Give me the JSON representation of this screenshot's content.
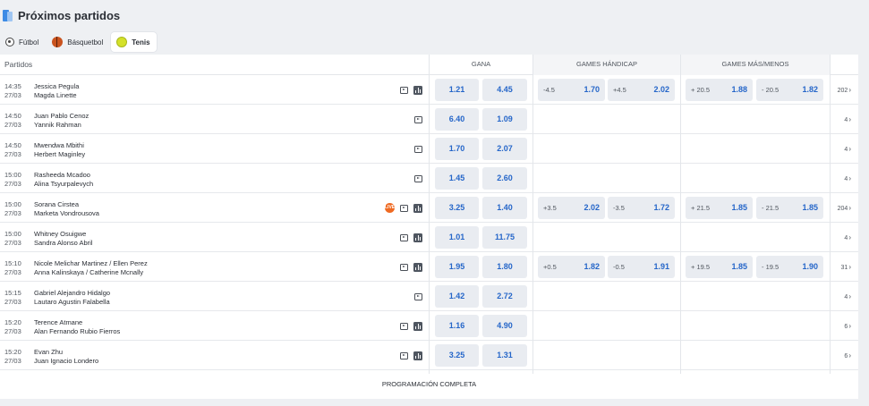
{
  "header": {
    "title": "Próximos partidos"
  },
  "tabs": [
    {
      "label": "Fútbol",
      "icon": "soccer-ball-icon"
    },
    {
      "label": "Básquetbol",
      "icon": "basketball-icon"
    },
    {
      "label": "Tenis",
      "icon": "tennis-ball-icon",
      "active": true
    }
  ],
  "table": {
    "columns": {
      "matches": "Partidos",
      "win": "GANA",
      "handicap": "GAMES HÁNDICAP",
      "overunder": "GAMES MÁS/MENOS"
    },
    "rows": [
      {
        "time": "14:35",
        "date": "27/03",
        "team1": "Jessica Pegula",
        "team2": "Magda Linette",
        "live": false,
        "stats": true,
        "win": [
          "1.21",
          "4.45"
        ],
        "handicap": [
          {
            "label": "-4.5",
            "value": "1.70"
          },
          {
            "label": "+4.5",
            "value": "2.02"
          }
        ],
        "overunder": [
          {
            "label": "+ 20.5",
            "value": "1.88"
          },
          {
            "label": "- 20.5",
            "value": "1.82"
          }
        ],
        "more": "202"
      },
      {
        "time": "14:50",
        "date": "27/03",
        "team1": "Juan Pablo Cenoz",
        "team2": "Yannik Rahman",
        "live": false,
        "stats": false,
        "win": [
          "6.40",
          "1.09"
        ],
        "handicap": [],
        "overunder": [],
        "more": "4"
      },
      {
        "time": "14:50",
        "date": "27/03",
        "team1": "Mwendwa Mbithi",
        "team2": "Herbert Maginley",
        "live": false,
        "stats": false,
        "win": [
          "1.70",
          "2.07"
        ],
        "handicap": [],
        "overunder": [],
        "more": "4"
      },
      {
        "time": "15:00",
        "date": "27/03",
        "team1": "Rasheeda Mcadoo",
        "team2": "Alina Tsyurpalevych",
        "live": false,
        "stats": false,
        "notv": true,
        "win": [
          "1.45",
          "2.60"
        ],
        "handicap": [],
        "overunder": [],
        "more": "4"
      },
      {
        "time": "15:00",
        "date": "27/03",
        "team1": "Sorana Cirstea",
        "team2": "Marketa Vondrousova",
        "live": true,
        "stats": true,
        "win": [
          "3.25",
          "1.40"
        ],
        "handicap": [
          {
            "label": "+3.5",
            "value": "2.02"
          },
          {
            "label": "-3.5",
            "value": "1.72"
          }
        ],
        "overunder": [
          {
            "label": "+ 21.5",
            "value": "1.85"
          },
          {
            "label": "- 21.5",
            "value": "1.85"
          }
        ],
        "more": "204"
      },
      {
        "time": "15:00",
        "date": "27/03",
        "team1": "Whitney Osuigwe",
        "team2": "Sandra Alonso Abril",
        "live": false,
        "stats": true,
        "win": [
          "1.01",
          "11.75"
        ],
        "handicap": [],
        "overunder": [],
        "more": "4"
      },
      {
        "time": "15:10",
        "date": "27/03",
        "team1": "Nicole Melichar Martinez / Ellen Perez",
        "team2": "Anna Kalinskaya / Catherine Mcnally",
        "live": false,
        "stats": true,
        "win": [
          "1.95",
          "1.80"
        ],
        "handicap": [
          {
            "label": "+0.5",
            "value": "1.82"
          },
          {
            "label": "-0.5",
            "value": "1.91"
          }
        ],
        "overunder": [
          {
            "label": "+ 19.5",
            "value": "1.85"
          },
          {
            "label": "- 19.5",
            "value": "1.90"
          }
        ],
        "more": "31"
      },
      {
        "time": "15:15",
        "date": "27/03",
        "team1": "Gabriel Alejandro Hidalgo",
        "team2": "Lautaro Agustin Falabella",
        "live": false,
        "stats": false,
        "win": [
          "1.42",
          "2.72"
        ],
        "handicap": [],
        "overunder": [],
        "more": "4"
      },
      {
        "time": "15:20",
        "date": "27/03",
        "team1": "Terence Atmane",
        "team2": "Alan Fernando Rubio Fierros",
        "live": false,
        "stats": true,
        "win": [
          "1.16",
          "4.90"
        ],
        "handicap": [],
        "overunder": [],
        "more": "6"
      },
      {
        "time": "15:20",
        "date": "27/03",
        "team1": "Evan Zhu",
        "team2": "Juan Ignacio Londero",
        "live": false,
        "stats": true,
        "win": [
          "3.25",
          "1.31"
        ],
        "handicap": [],
        "overunder": [],
        "more": "6"
      }
    ]
  },
  "footer": {
    "label": "PROGRAMACIÓN COMPLETA"
  },
  "colors": {
    "odds": "#2566c9",
    "oddBg": "#e9ecf1",
    "headerShade": "#f4f5f7",
    "pageBg": "#eef0f3",
    "live": "#ef6a22"
  }
}
